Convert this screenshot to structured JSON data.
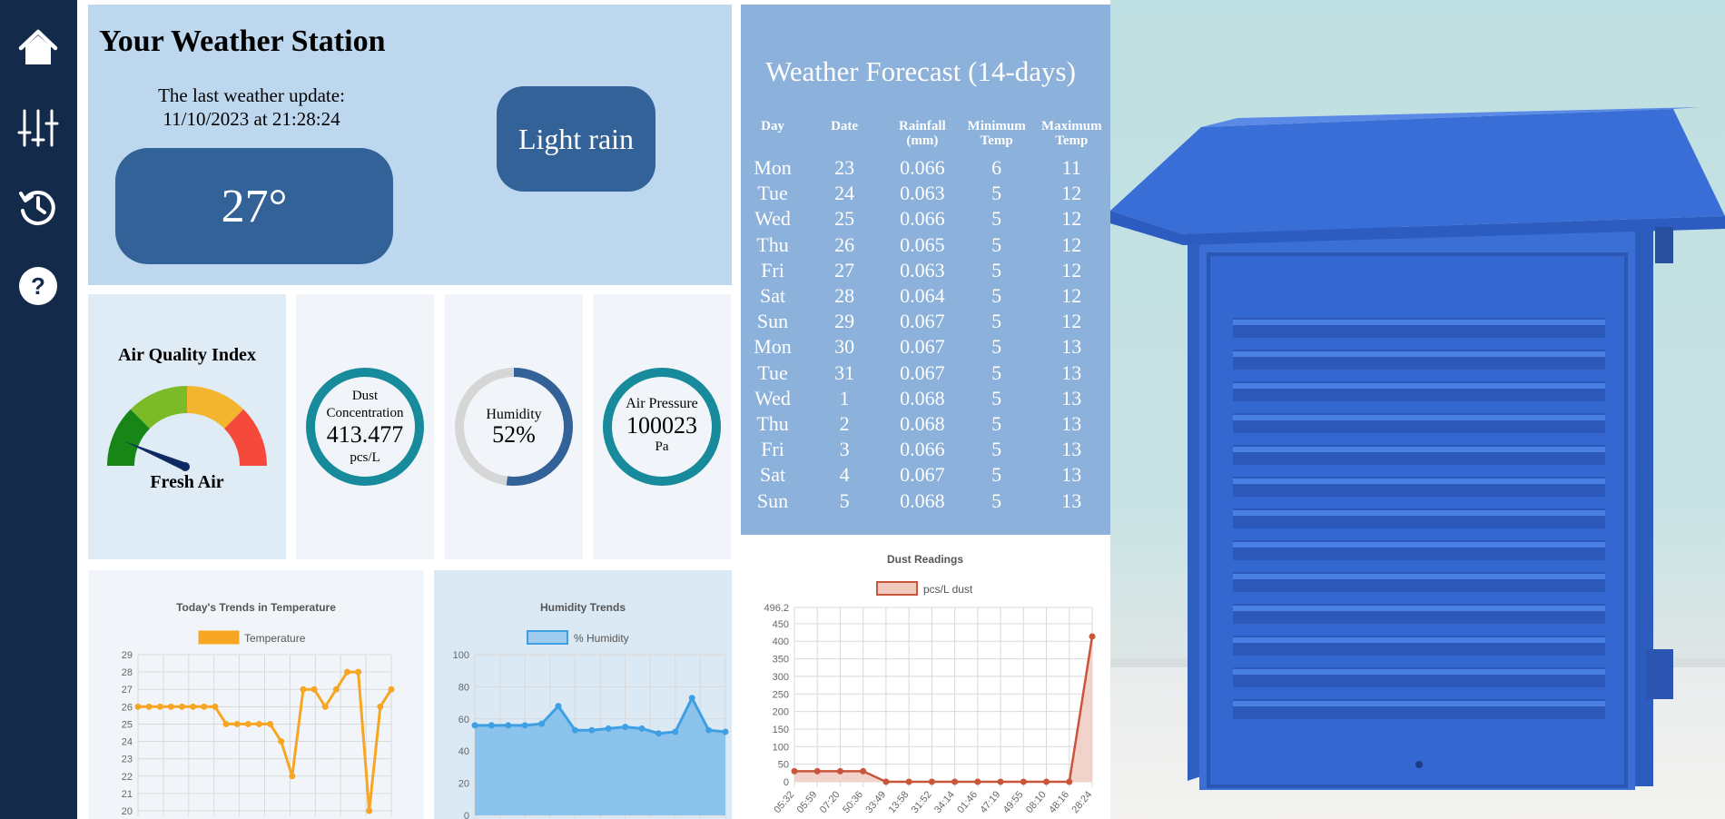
{
  "sidebar": {
    "items": [
      {
        "name": "home",
        "icon": "home-icon"
      },
      {
        "name": "settings",
        "icon": "sliders-icon"
      },
      {
        "name": "history",
        "icon": "history-icon"
      },
      {
        "name": "help",
        "icon": "help-icon"
      }
    ]
  },
  "header": {
    "title": "Your Weather Station",
    "update_label": "The last weather update:",
    "update_time": "11/10/2023 at 21:28:24",
    "temperature": "27°",
    "condition": "Light rain"
  },
  "gauges": {
    "aqi": {
      "title": "Air Quality Index",
      "status": "Fresh Air"
    },
    "dust": {
      "label_line1": "Dust",
      "label_line2": "Concentration",
      "value": "413.477",
      "unit": "pcs/L"
    },
    "humidity": {
      "label": "Humidity",
      "value": "52%",
      "fraction": 0.52
    },
    "pressure": {
      "label": "Air Pressure",
      "value": "100023",
      "unit": "Pa"
    }
  },
  "forecast": {
    "title": "Weather Forecast (14-days)",
    "columns": [
      "Day",
      "Date",
      "Rainfall (mm)",
      "Minimum Temp",
      "Maximum Temp"
    ],
    "header_lines": [
      [
        "Day"
      ],
      [
        "Date"
      ],
      [
        "Rainfall",
        "(mm)"
      ],
      [
        "Minimum",
        "Temp"
      ],
      [
        "Maximum",
        "Temp"
      ]
    ],
    "rows": [
      [
        "Mon",
        "23",
        "0.066",
        "6",
        "11"
      ],
      [
        "Tue",
        "24",
        "0.063",
        "5",
        "12"
      ],
      [
        "Wed",
        "25",
        "0.066",
        "5",
        "12"
      ],
      [
        "Thu",
        "26",
        "0.065",
        "5",
        "12"
      ],
      [
        "Fri",
        "27",
        "0.063",
        "5",
        "12"
      ],
      [
        "Sat",
        "28",
        "0.064",
        "5",
        "12"
      ],
      [
        "Sun",
        "29",
        "0.067",
        "5",
        "12"
      ],
      [
        "Mon",
        "30",
        "0.067",
        "5",
        "13"
      ],
      [
        "Tue",
        "31",
        "0.067",
        "5",
        "13"
      ],
      [
        "Wed",
        "1",
        "0.068",
        "5",
        "13"
      ],
      [
        "Thu",
        "2",
        "0.068",
        "5",
        "13"
      ],
      [
        "Fri",
        "3",
        "0.066",
        "5",
        "13"
      ],
      [
        "Sat",
        "4",
        "0.067",
        "5",
        "13"
      ],
      [
        "Sun",
        "5",
        "0.068",
        "5",
        "13"
      ]
    ]
  },
  "colors": {
    "sidebar": "#132a4b",
    "header_bg": "#bdd7ef",
    "pill": "#336299",
    "forecast_bg": "#8cb1da",
    "teal_ring": "#178a9c",
    "temperature_line": "#f6a623",
    "humidity_line": "#3ea0e3",
    "dust_line": "#c9553a"
  },
  "chart_data": [
    {
      "type": "line",
      "title": "Today's Trends in Temperature",
      "series": [
        {
          "name": "Temperature",
          "values": [
            26,
            26,
            26,
            26,
            26,
            26,
            26,
            26,
            25,
            25,
            25,
            25,
            25,
            24,
            22,
            27,
            27,
            26,
            27,
            28,
            28,
            20,
            26,
            27
          ]
        }
      ],
      "y_ticks": [
        20,
        21,
        22,
        23,
        24,
        25,
        26,
        27,
        28,
        29
      ],
      "ylim": [
        20,
        29
      ],
      "grid": true,
      "legend": "top"
    },
    {
      "type": "area",
      "title": "Humidity Trends",
      "series": [
        {
          "name": "% Humidity",
          "values": [
            56,
            56,
            56,
            56,
            57,
            68,
            53,
            53,
            54,
            55,
            54,
            51,
            52,
            73,
            53,
            52
          ]
        }
      ],
      "y_ticks": [
        0,
        20,
        40,
        60,
        80,
        100
      ],
      "ylim": [
        0,
        100
      ],
      "grid": true,
      "legend": "top"
    },
    {
      "type": "area",
      "title": "Dust Readings",
      "series": [
        {
          "name": "pcs/L dust",
          "values": [
            30,
            30,
            30,
            30,
            0,
            0,
            0,
            0,
            0,
            0,
            0,
            0,
            0,
            413.5
          ]
        }
      ],
      "x_labels": [
        "05:32",
        "05:59",
        "07:20",
        "50:36",
        "33:49",
        "13:58",
        "31:52",
        "34:14",
        "01:46",
        "47:19",
        "49:55",
        "08:10",
        "48:16",
        "28:24"
      ],
      "y_ticks": [
        "496.2",
        "450",
        "400",
        "350",
        "300",
        "250",
        "200",
        "150",
        "100",
        "50",
        "0"
      ],
      "ylim": [
        0,
        496.2
      ],
      "grid": true,
      "legend": "top"
    }
  ]
}
